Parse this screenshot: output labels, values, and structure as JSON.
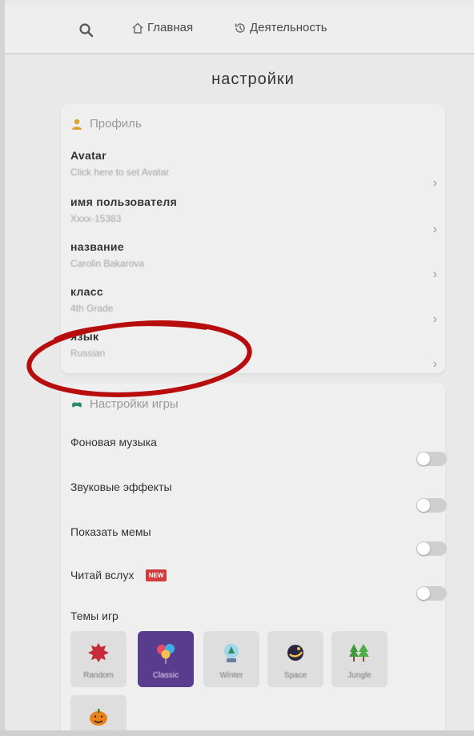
{
  "nav": {
    "home_label": "Главная",
    "activity_label": "Деятельность"
  },
  "page": {
    "title": "настройки"
  },
  "profile": {
    "section_title": "Профиль",
    "rows": [
      {
        "label": "Avatar",
        "value": "Click here to set Avatar"
      },
      {
        "label": "имя пользователя",
        "value": "Xxxx-15383"
      },
      {
        "label": "название",
        "value": "Carolin Bakarova"
      },
      {
        "label": "класс",
        "value": "4th Grade"
      },
      {
        "label": "язык",
        "value": "Russian"
      }
    ]
  },
  "settings": {
    "section_title": "Настройки игры",
    "toggles": [
      {
        "label": "Фоновая музыка",
        "on": false
      },
      {
        "label": "Звуковые эффекты",
        "on": false
      },
      {
        "label": "Показать мемы",
        "on": false
      },
      {
        "label": "Читай вслух",
        "on": false,
        "badge": "NEW"
      }
    ],
    "themes_label": "Темы игр",
    "themes": [
      {
        "name": "Random",
        "icon": "red-blob-icon",
        "selected": false
      },
      {
        "name": "Classic",
        "icon": "balloons-icon",
        "selected": true
      },
      {
        "name": "Winter",
        "icon": "snow-globe-icon",
        "selected": false
      },
      {
        "name": "Space",
        "icon": "planet-icon",
        "selected": false
      },
      {
        "name": "Jungle",
        "icon": "trees-icon",
        "selected": false
      },
      {
        "name": "",
        "icon": "pumpkin-icon",
        "selected": false
      }
    ]
  },
  "colors": {
    "accent_selected": "#5a3c8e",
    "badge_red": "#d23b3b",
    "annotation_red": "#b80d0d"
  }
}
